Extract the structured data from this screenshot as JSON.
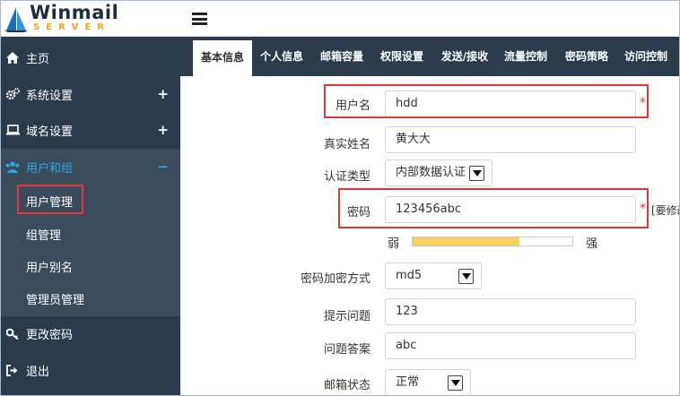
{
  "brand": {
    "name": "Winmail",
    "sub": "SERVER",
    "colors": {
      "accent": "#29a8e0",
      "sidebar": "#2c3b4b",
      "sidebar_active": "#3a4b5c",
      "highlight": "#e53535",
      "strength": "#f6cf5e"
    }
  },
  "sidebar": {
    "items": [
      {
        "label": "主页",
        "icon": "home-icon"
      },
      {
        "label": "系统设置",
        "icon": "gears-icon",
        "expander": "+"
      },
      {
        "label": "域名设置",
        "icon": "laptop-icon",
        "expander": "+"
      },
      {
        "label": "用户和组",
        "icon": "users-icon",
        "expander": "−"
      },
      {
        "label": "更改密码",
        "icon": "key-icon"
      },
      {
        "label": "退出",
        "icon": "sign-out-icon"
      }
    ],
    "subitems": [
      "用户管理",
      "组管理",
      "用户别名",
      "管理员管理"
    ]
  },
  "tabs": [
    "基本信息",
    "个人信息",
    "邮箱容量",
    "权限设置",
    "发送/接收",
    "流量控制",
    "密码策略",
    "访问控制"
  ],
  "form": {
    "username": {
      "label": "用户名",
      "value": "hdd",
      "required": "*"
    },
    "realname": {
      "label": "真实姓名",
      "value": "黄大大"
    },
    "auth": {
      "label": "认证类型",
      "value": "内部数据认证"
    },
    "password": {
      "label": "密码",
      "value": "123456abc",
      "required": "*",
      "note": "[要修改"
    },
    "strength": {
      "weak": "弱",
      "strong": "强",
      "level": 0.67
    },
    "encrypt": {
      "label": "密码加密方式",
      "value": "md5"
    },
    "question": {
      "label": "提示问题",
      "value": "123"
    },
    "answer": {
      "label": "问题答案",
      "value": "abc"
    },
    "status": {
      "label": "邮箱状态",
      "value": "正常"
    }
  }
}
